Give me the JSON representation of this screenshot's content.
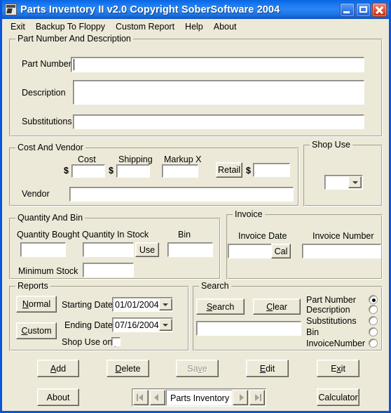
{
  "window": {
    "title": "Parts Inventory II v2.0 Copyright SoberSoftware 2004",
    "minimize_label": "Minimize",
    "maximize_label": "Maximize",
    "close_label": "Close",
    "titlebar_color": "#1B78F0",
    "face_color": "#ECE9D8"
  },
  "menu": [
    {
      "label": "Exit"
    },
    {
      "label": "Backup To Floppy"
    },
    {
      "label": "Custom Report"
    },
    {
      "label": "Help"
    },
    {
      "label": "About"
    }
  ],
  "part_group": {
    "title": "Part Number And Description",
    "part_number_label": "Part Number",
    "part_number_value": "",
    "description_label": "Description",
    "description_value": "",
    "substitutions_label": "Substitutions",
    "substitutions_value": ""
  },
  "cost_group": {
    "title": "Cost And Vendor",
    "cost_label": "Cost",
    "cost_value": "",
    "cost_currency": "$",
    "shipping_label": "Shipping",
    "shipping_value": "",
    "shipping_currency": "$",
    "markup_label": "Markup X",
    "markup_value": "",
    "retail_button": "Retail",
    "retail_currency": "$",
    "retail_value": "",
    "vendor_label": "Vendor",
    "vendor_value": ""
  },
  "shop_use_group": {
    "title": "Shop Use",
    "selected": "",
    "options": []
  },
  "quantity_group": {
    "title": "Quantity And Bin",
    "quantity_bought_label": "Quantity Bought",
    "quantity_bought_value": "",
    "quantity_in_stock_label": "Quantity In Stock",
    "quantity_in_stock_value": "",
    "use_button": "Use",
    "bin_label": "Bin",
    "bin_value": "",
    "minimum_stock_label": "Minimum Stock",
    "minimum_stock_value": ""
  },
  "invoice_group": {
    "title": "Invoice",
    "invoice_date_label": "Invoice Date",
    "invoice_date_value": "",
    "cal_button": "Cal",
    "invoice_number_label": "Invoice Number",
    "invoice_number_value": ""
  },
  "reports_group": {
    "title": "Reports",
    "normal_button": "Normal",
    "normal_accel": "N",
    "custom_button": "Custom",
    "custom_accel": "C",
    "starting_date_label": "Starting Date:",
    "starting_date_value": "01/01/2004",
    "ending_date_label": "Ending Date:",
    "ending_date_value": "07/16/2004",
    "shop_use_only_label": "Shop Use only",
    "shop_use_only_checked": false
  },
  "search_group": {
    "title": "Search",
    "search_button": "Search",
    "search_accel": "S",
    "clear_button": "Clear",
    "clear_accel": "C",
    "search_value": "",
    "radios": [
      {
        "label": "Part Number",
        "selected": true
      },
      {
        "label": "Description",
        "selected": false
      },
      {
        "label": "Substitutions",
        "selected": false
      },
      {
        "label": "Bin",
        "selected": false
      },
      {
        "label": "InvoiceNumber",
        "selected": false
      }
    ]
  },
  "actions": {
    "add": "Add",
    "add_accel": "A",
    "delete": "Delete",
    "delete_accel": "D",
    "save": "Save",
    "save_accel": "v",
    "save_enabled": false,
    "edit": "Edit",
    "edit_accel": "E",
    "exit": "Exit",
    "exit_accel": "x",
    "about": "About",
    "calculator": "Calculator"
  },
  "navigator": {
    "first_label": "First record",
    "previous_label": "Previous record",
    "text": "Parts Inventory",
    "next_label": "Next record",
    "last_label": "Last record"
  }
}
